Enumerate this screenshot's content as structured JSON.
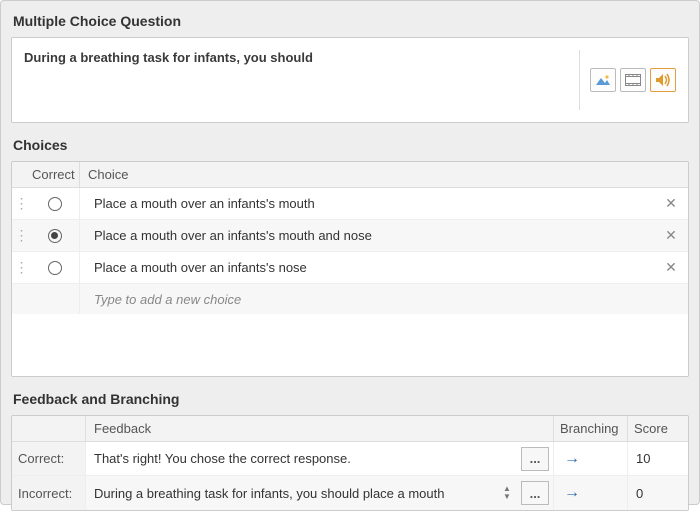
{
  "section_titles": {
    "question": "Multiple Choice Question",
    "choices": "Choices",
    "feedback": "Feedback and Branching"
  },
  "question": {
    "text": "During a breathing task for infants, you should"
  },
  "choices_header": {
    "correct": "Correct",
    "choice": "Choice"
  },
  "choices": [
    {
      "text": "Place a mouth over an infants's mouth",
      "correct": false
    },
    {
      "text": "Place a mouth over an infants's mouth and nose",
      "correct": true
    },
    {
      "text": "Place a mouth over an infants's nose",
      "correct": false
    }
  ],
  "new_choice_placeholder": "Type to add a new choice",
  "feedback_header": {
    "feedback": "Feedback",
    "branching": "Branching",
    "score": "Score"
  },
  "feedback": {
    "correct": {
      "label": "Correct:",
      "text": "That's right! You chose the correct response.",
      "score": "10"
    },
    "incorrect": {
      "label": "Incorrect:",
      "text": "During a breathing task for infants, you should place a mouth",
      "score": "0"
    }
  },
  "more_label": "...",
  "arrow_glyph": "→"
}
